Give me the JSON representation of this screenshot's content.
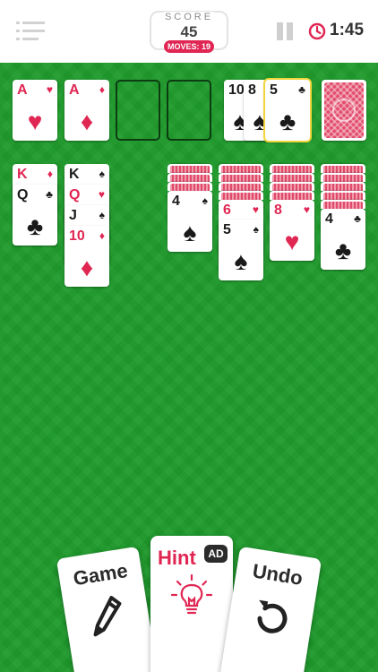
{
  "header": {
    "score_label": "SCORE",
    "score": "45",
    "moves": "MOVES: 19",
    "timer": "1:45",
    "icons": [
      "menu-icon",
      "pause-icon",
      "clock-icon"
    ]
  },
  "colors": {
    "felt": "#1f9b2c",
    "red_suit": "#e02653",
    "black_suit": "#1a1a1a",
    "card_back": "#e24a6a",
    "highlight": "#f2d53c"
  },
  "foundations": [
    {
      "rank": "A",
      "suit": "♥",
      "color": "red"
    },
    {
      "rank": "A",
      "suit": "♦",
      "color": "red"
    },
    {
      "rank": "",
      "suit": "",
      "color": "empty"
    },
    {
      "rank": "",
      "suit": "",
      "color": "empty"
    }
  ],
  "waste": [
    {
      "rank": "10",
      "suit": "♠",
      "color": "black"
    },
    {
      "rank": "8",
      "suit": "♠",
      "color": "black"
    },
    {
      "rank": "5",
      "suit": "♣",
      "color": "black",
      "highlighted": true
    }
  ],
  "tableau": [
    {
      "hidden": 0,
      "cards": [
        {
          "rank": "K",
          "suit": "♦",
          "color": "red"
        },
        {
          "rank": "Q",
          "suit": "♣",
          "color": "black"
        }
      ]
    },
    {
      "hidden": 0,
      "cards": [
        {
          "rank": "K",
          "suit": "♠",
          "color": "black"
        },
        {
          "rank": "Q",
          "suit": "♥",
          "color": "red"
        },
        {
          "rank": "J",
          "suit": "♠",
          "color": "black"
        },
        {
          "rank": "10",
          "suit": "♦",
          "color": "red"
        }
      ]
    },
    {
      "hidden": 0,
      "cards": []
    },
    {
      "hidden": 3,
      "cards": [
        {
          "rank": "4",
          "suit": "♠",
          "color": "black"
        }
      ]
    },
    {
      "hidden": 4,
      "cards": [
        {
          "rank": "6",
          "suit": "♥",
          "color": "red"
        },
        {
          "rank": "5",
          "suit": "♠",
          "color": "black"
        }
      ]
    },
    {
      "hidden": 4,
      "cards": [
        {
          "rank": "8",
          "suit": "♥",
          "color": "red"
        }
      ]
    },
    {
      "hidden": 5,
      "cards": [
        {
          "rank": "4",
          "suit": "♣",
          "color": "black"
        }
      ]
    }
  ],
  "actions": {
    "game": "Game",
    "hint": "Hint",
    "ad": "AD",
    "undo": "Undo"
  }
}
